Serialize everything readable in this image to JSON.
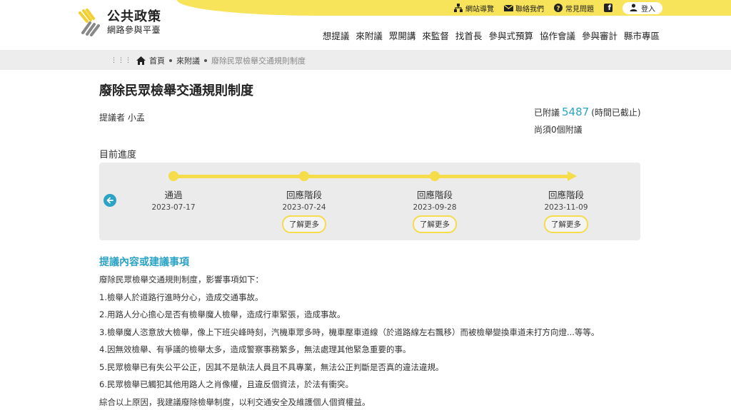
{
  "header": {
    "logo_title": "公共政策",
    "logo_sub": "網路參與平臺",
    "utility": {
      "sitemap": "網站導覽",
      "contact": "聯絡我們",
      "faq": "常見問題",
      "login": "登入"
    },
    "nav": [
      "想提議",
      "來附議",
      "眾開講",
      "來監督",
      "找首長",
      "參與式預算",
      "協作會議",
      "參與審計",
      "縣市專區"
    ]
  },
  "breadcrumb": {
    "home": "首頁",
    "level1": "來附議",
    "current": "廢除民眾檢舉交通規則制度"
  },
  "proposal": {
    "title": "廢除民眾檢舉交通規則制度",
    "proposer_label": "提議者",
    "proposer_name": "小孟",
    "signed_label": "已附議",
    "signed_count": "5487",
    "deadline_note": "(時間已截止)",
    "needed_text": "尚須0個附議"
  },
  "progress": {
    "title": "目前進度",
    "stages": [
      {
        "label": "通過",
        "date": "2023-07-17"
      },
      {
        "label": "回應階段",
        "date": "2023-07-24",
        "more": "了解更多"
      },
      {
        "label": "回應階段",
        "date": "2023-09-28",
        "more": "了解更多"
      },
      {
        "label": "回應階段",
        "date": "2023-11-09",
        "more": "了解更多"
      }
    ]
  },
  "content": {
    "section_title": "提議內容或建議事項",
    "paragraphs": [
      "廢除民眾檢舉交通規則制度，影響事項如下：",
      "1.檢舉人於道路行進時分心，造成交通事故。",
      "2.用路人分心擔心是否有檢舉魔人檢舉，造成行車緊張，造成事故。",
      "3.檢舉魔人恣意放大檢舉，像上下班尖峰時刻，汽機車眾多時，機車壓車道線（於道路線左右飄移）而被檢舉變換車道未打方向燈...等等。",
      "4.因無效檢舉、有爭議的檢舉太多，造成警察事務繁多，無法處理其他緊急重要的事。",
      "5.民眾檢舉已有失公平公正，因其不是執法人員且不具專業，無法公正判斷是否真的違法違規。",
      "6.民眾檢舉已觸犯其他用路人之肖像權，且違反個資法，於法有衝突。",
      "綜合以上原因，我建議廢除檢舉制度，以利交通安全及維護個人個資權益。"
    ]
  },
  "colors": {
    "brand_yellow": "#f8e45a",
    "accent_teal": "#2aa3c4"
  }
}
